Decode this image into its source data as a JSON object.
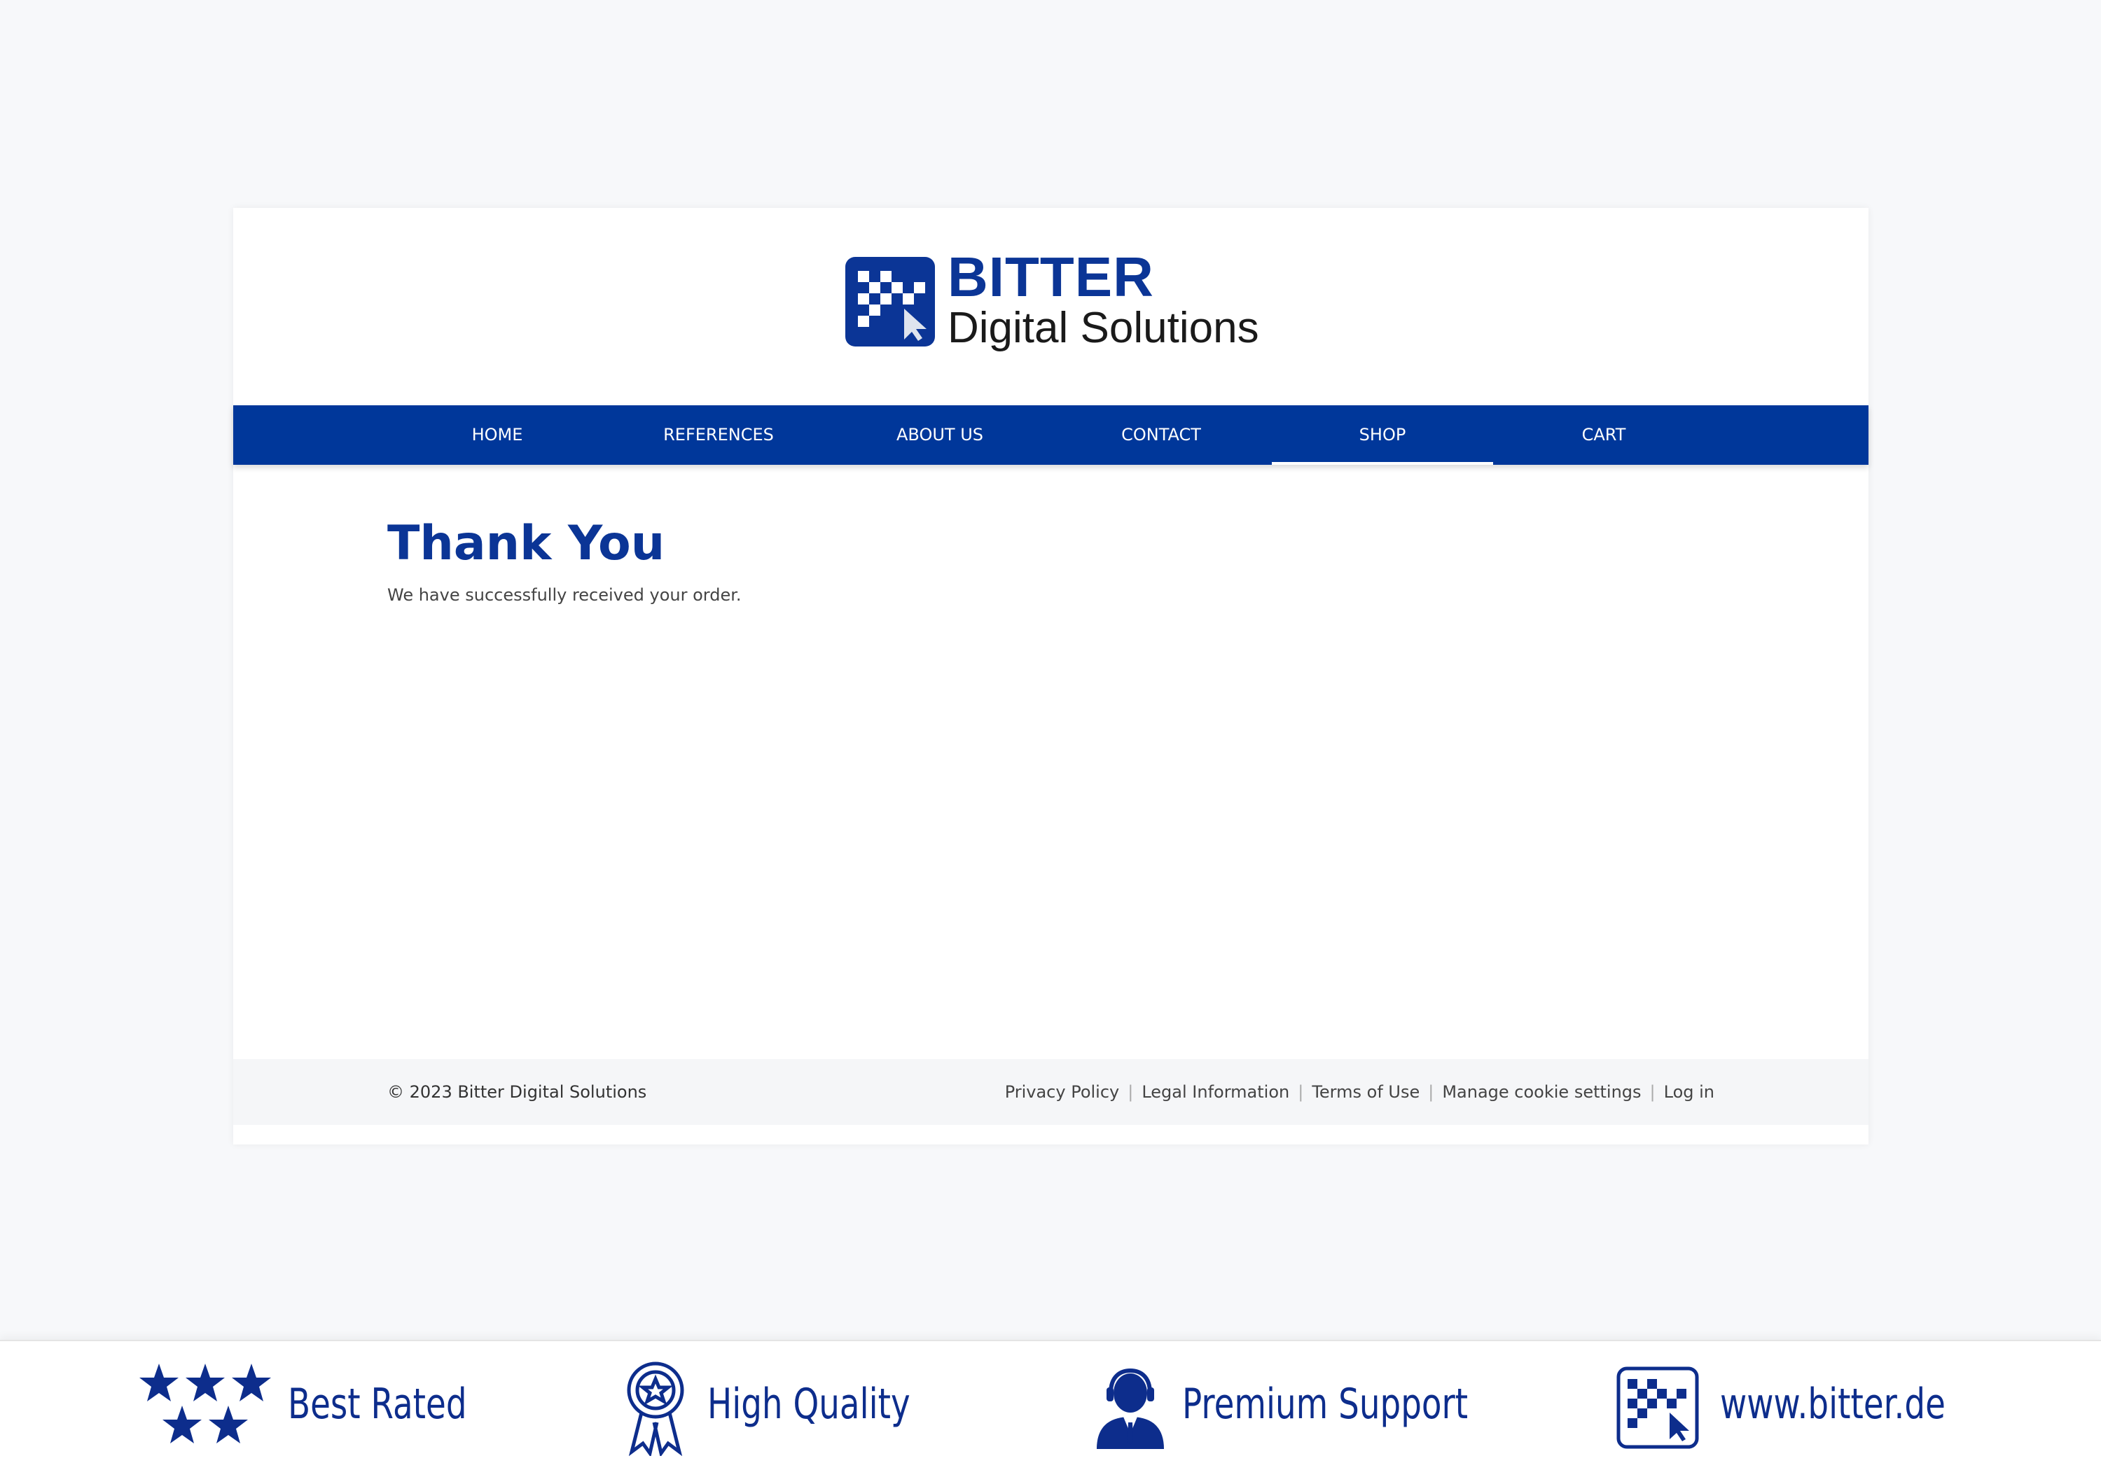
{
  "header": {
    "logo_title": "BITTER",
    "logo_subtitle": "Digital Solutions"
  },
  "nav": {
    "items": [
      {
        "label": "HOME"
      },
      {
        "label": "REFERENCES"
      },
      {
        "label": "ABOUT US"
      },
      {
        "label": "CONTACT"
      },
      {
        "label": "SHOP",
        "active": true
      },
      {
        "label": "CART"
      }
    ]
  },
  "main": {
    "title": "Thank You",
    "message": "We have successfully received your order."
  },
  "footer": {
    "copyright": "© 2023 Bitter Digital Solutions",
    "links": [
      {
        "label": "Privacy Policy"
      },
      {
        "label": "Legal Information"
      },
      {
        "label": "Terms of Use"
      },
      {
        "label": "Manage cookie settings"
      },
      {
        "label": "Log in"
      }
    ]
  },
  "banner": {
    "badges": [
      {
        "label": "Best Rated",
        "icon": "stars-icon"
      },
      {
        "label": "High Quality",
        "icon": "award-ribbon-icon"
      },
      {
        "label": "Premium Support",
        "icon": "support-agent-icon"
      },
      {
        "label": "www.bitter.de",
        "icon": "bitter-logo-icon"
      }
    ]
  },
  "colors": {
    "brand_blue": "#00379a",
    "title_blue": "#0b3596",
    "page_background": "#f7f8fa",
    "footer_background": "#f5f6f8"
  }
}
